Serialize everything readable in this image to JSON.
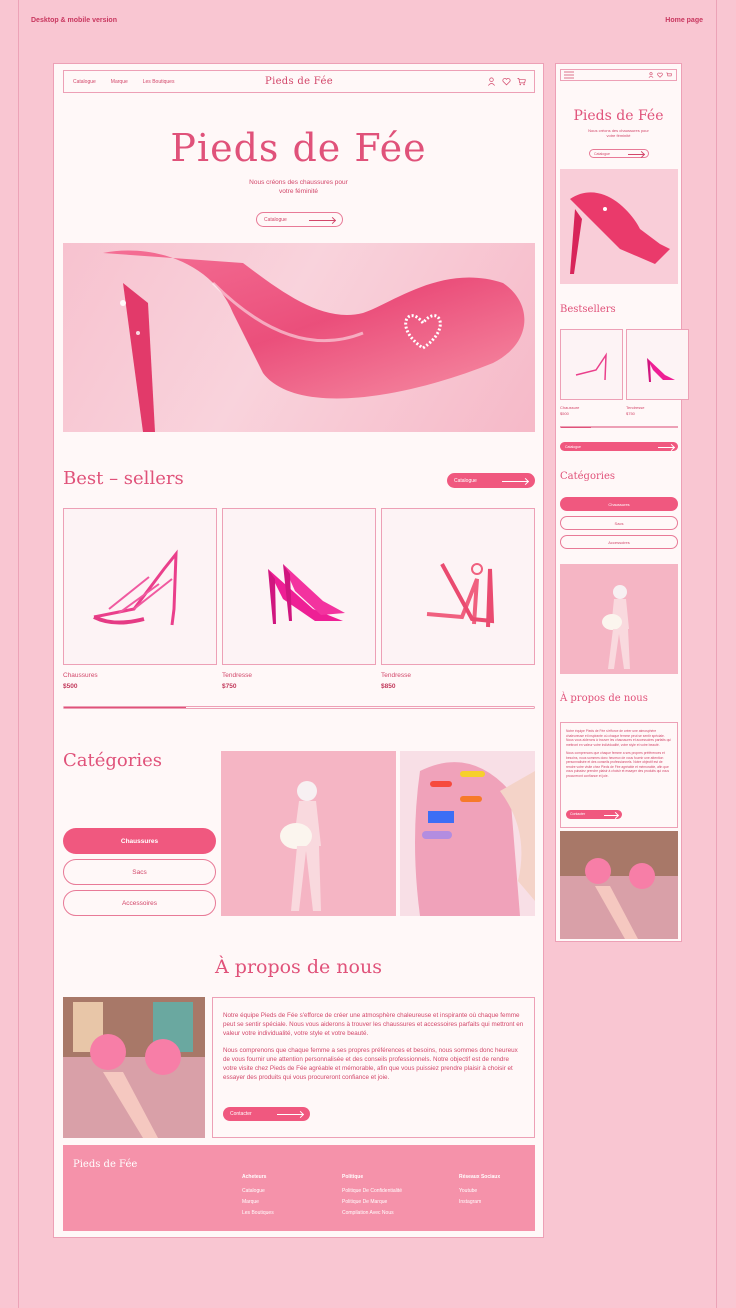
{
  "meta": {
    "left_note": "Desktop & mobile version",
    "right_note": "Home page"
  },
  "nav": {
    "links": [
      "Catalogue",
      "Marque",
      "Les Boutiques"
    ],
    "logo": "Pieds de Fée"
  },
  "hero": {
    "title": "Pieds de Fée",
    "subtitle_line1": "Nous créons des chaussures pour",
    "subtitle_line2": "votre féminité",
    "cta": "Catalogue"
  },
  "bestsellers": {
    "title": "Best – sellers",
    "cta": "Catalogue",
    "products": [
      {
        "name": "Chaussures",
        "price": "$500"
      },
      {
        "name": "Tendresse",
        "price": "$750"
      },
      {
        "name": "Tendresse",
        "price": "$850"
      }
    ],
    "scroll_progress": 0.26
  },
  "categories": {
    "title": "Catégories",
    "items": [
      {
        "label": "Chaussures",
        "active": true
      },
      {
        "label": "Sacs",
        "active": false
      },
      {
        "label": "Accessoires",
        "active": false
      }
    ]
  },
  "about": {
    "title": "À propos de nous",
    "p1": "Notre équipe Pieds de Fée s'efforce de créer une atmosphère chaleureuse et inspirante où chaque femme peut se sentir spéciale. Nous vous aiderons à trouver les chaussures et accessoires parfaits qui mettront en valeur votre individualité, votre style et votre beauté.",
    "p2": "Nous comprenons que chaque femme a ses propres préférences et besoins, nous sommes donc heureux de vous fournir une attention personnalisée et des conseils professionnels. Notre objectif est de rendre votre visite chez Pieds de Fée agréable et mémorable, afin que vous puissiez prendre plaisir à choisir et essayer des produits qui vous procureront confiance et joie.",
    "cta": "Contacter"
  },
  "footer": {
    "logo": "Pieds de Fée",
    "columns": [
      {
        "heading": "Acheteurs",
        "links": [
          "Catalogue",
          "Marque",
          "Les Boutiques"
        ]
      },
      {
        "heading": "Politique",
        "links": [
          "Politique De Confidentialité",
          "Politique De Marque",
          "Compilation Avec Nous"
        ]
      },
      {
        "heading": "Réseaux Sociaux",
        "links": [
          "Youtube",
          "Instagram"
        ]
      }
    ]
  },
  "mobile": {
    "title": "Pieds de Fée",
    "subtitle_line1": "Nous créons des chaussures pour",
    "subtitle_line2": "votre féminité",
    "cta": "Catalogue",
    "bestsellers_title": "Bestsellers",
    "products": [
      {
        "name": "Chaussure",
        "price": "$500"
      },
      {
        "name": "Tendresse",
        "price": "$750"
      }
    ],
    "catalogue_btn": "Catalogue",
    "categories_title": "Catégories",
    "categories": [
      "Chaussures",
      "Sacs",
      "Accessoires"
    ],
    "about_title": "À propos de nous",
    "about_p1": "Notre équipe Pieds de Fée s'efforce de créer une atmosphère chaleureuse et inspirante où chaque femme peut se sentir spéciale. Nous vous aiderons à trouver les chaussures et accessoires parfaits qui mettront en valeur votre individualité, votre style et votre beauté.",
    "about_p2": "Nous comprenons que chaque femme a ses propres préférences et besoins, nous sommes donc heureux de vous fournir une attention personnalisée et des conseils professionnels. Notre objectif est de rendre votre visite chez Pieds de Fée agréable et mémorable, afin que vous puissiez prendre plaisir à choisir et essayer des produits qui vous procureront confiance et joie.",
    "about_cta": "Contacter"
  },
  "colors": {
    "background": "#f9c6d2",
    "accent": "#f0587f",
    "text": "#d2476a",
    "footer": "#f592aa"
  },
  "icons": [
    "user-icon",
    "heart-icon",
    "cart-icon",
    "menu-icon"
  ]
}
